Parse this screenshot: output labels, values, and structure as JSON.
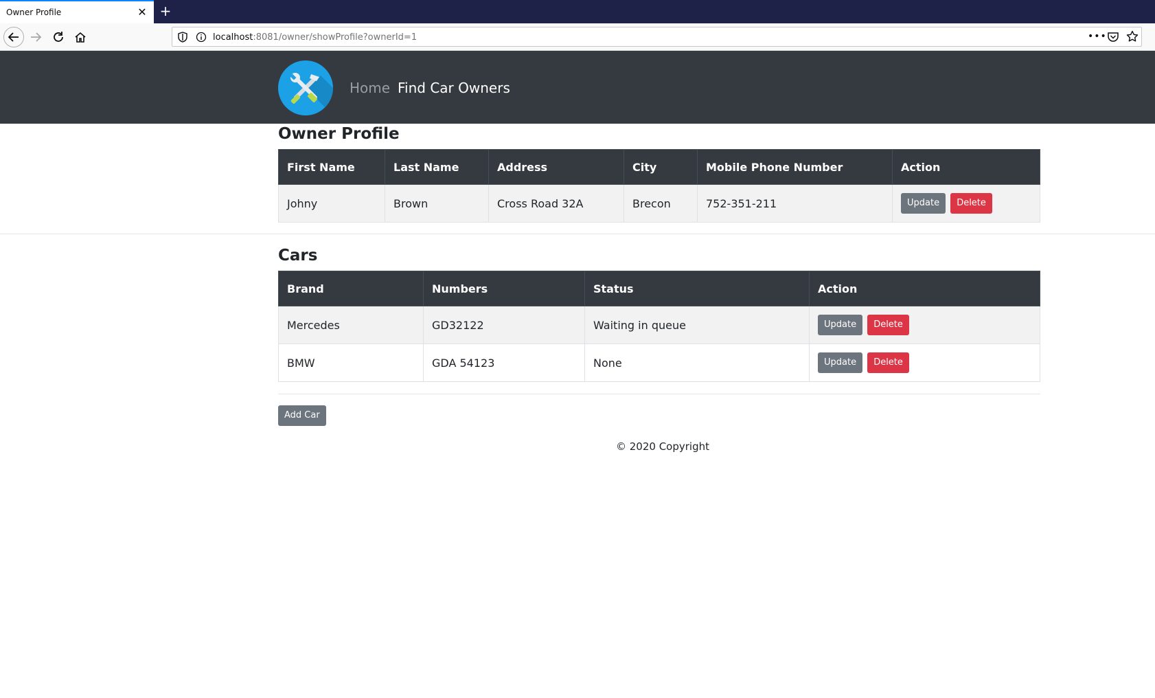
{
  "browser": {
    "tab_title": "Owner Profile",
    "tab_close": "✕",
    "new_tab": "+",
    "url_host": "localhost",
    "url_rest": ":8081/owner/showProfile?ownerId=1",
    "url_more": "•••"
  },
  "header": {
    "nav_home": "Home",
    "nav_find": "Find Car Owners"
  },
  "owner": {
    "title": "Owner Profile",
    "columns": [
      "First Name",
      "Last Name",
      "Address",
      "City",
      "Mobile Phone Number",
      "Action"
    ],
    "row": {
      "first_name": "Johny",
      "last_name": "Brown",
      "address": "Cross Road 32A",
      "city": "Brecon",
      "phone": "752-351-211"
    },
    "update_label": "Update",
    "delete_label": "Delete"
  },
  "cars": {
    "title": "Cars",
    "columns": [
      "Brand",
      "Numbers",
      "Status",
      "Action"
    ],
    "rows": [
      {
        "brand": "Mercedes",
        "numbers": "GD32122",
        "status": "Waiting in queue"
      },
      {
        "brand": "BMW",
        "numbers": "GDA 54123",
        "status": "None"
      }
    ],
    "update_label": "Update",
    "delete_label": "Delete",
    "add_label": "Add Car"
  },
  "footer": {
    "copyright": "© 2020 Copyright"
  },
  "colors": {
    "header_bg": "#343a40",
    "secondary": "#6c757d",
    "danger": "#dc3545",
    "logo_bg": "#1da1e6"
  }
}
